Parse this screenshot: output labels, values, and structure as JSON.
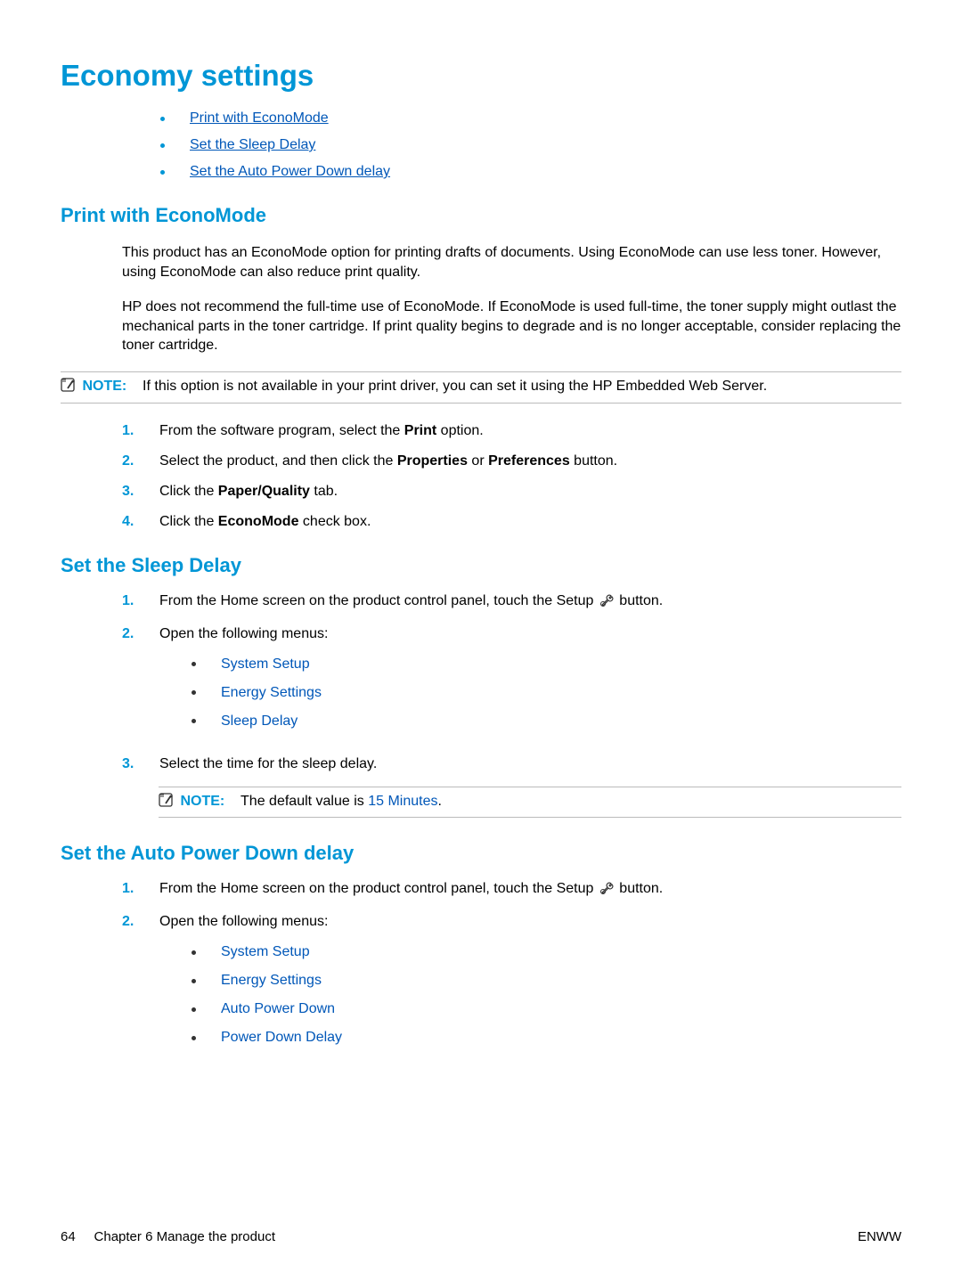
{
  "title": "Economy settings",
  "toc": {
    "item1": "Print with EconoMode",
    "item2": "Set the Sleep Delay",
    "item3": "Set the Auto Power Down delay"
  },
  "section1": {
    "heading": "Print with EconoMode",
    "para1": "This product has an EconoMode option for printing drafts of documents. Using EconoMode can use less toner. However, using EconoMode can also reduce print quality.",
    "para2": "HP does not recommend the full-time use of EconoMode. If EconoMode is used full-time, the toner supply might outlast the mechanical parts in the toner cartridge. If print quality begins to degrade and is no longer acceptable, consider replacing the toner cartridge.",
    "note_label": "NOTE:",
    "note_text": "If this option is not available in your print driver, you can set it using the HP Embedded Web Server.",
    "steps": {
      "s1_pre": "From the software program, select the ",
      "s1_bold": "Print",
      "s1_post": " option.",
      "s2_pre": "Select the product, and then click the ",
      "s2_b1": "Properties",
      "s2_mid": " or ",
      "s2_b2": "Preferences",
      "s2_post": " button.",
      "s3_pre": "Click the ",
      "s3_bold": "Paper/Quality",
      "s3_post": " tab.",
      "s4_pre": "Click the ",
      "s4_bold": "EconoMode",
      "s4_post": " check box."
    }
  },
  "section2": {
    "heading": "Set the Sleep Delay",
    "s1_pre": "From the Home screen on the product control panel, touch the Setup ",
    "s1_post": " button.",
    "s2": "Open the following menus:",
    "menu1": "System Setup",
    "menu2": "Energy Settings",
    "menu3": "Sleep Delay",
    "s3": "Select the time for the sleep delay.",
    "note_label": "NOTE:",
    "note_pre": "The default value is ",
    "note_val": "15 Minutes",
    "note_post": "."
  },
  "section3": {
    "heading": "Set the Auto Power Down delay",
    "s1_pre": "From the Home screen on the product control panel, touch the Setup ",
    "s1_post": " button.",
    "s2": "Open the following menus:",
    "menu1": "System Setup",
    "menu2": "Energy Settings",
    "menu3": "Auto Power Down",
    "menu4": "Power Down Delay"
  },
  "footer": {
    "page": "64",
    "chapter": "Chapter 6   Manage the product",
    "right": "ENWW"
  }
}
